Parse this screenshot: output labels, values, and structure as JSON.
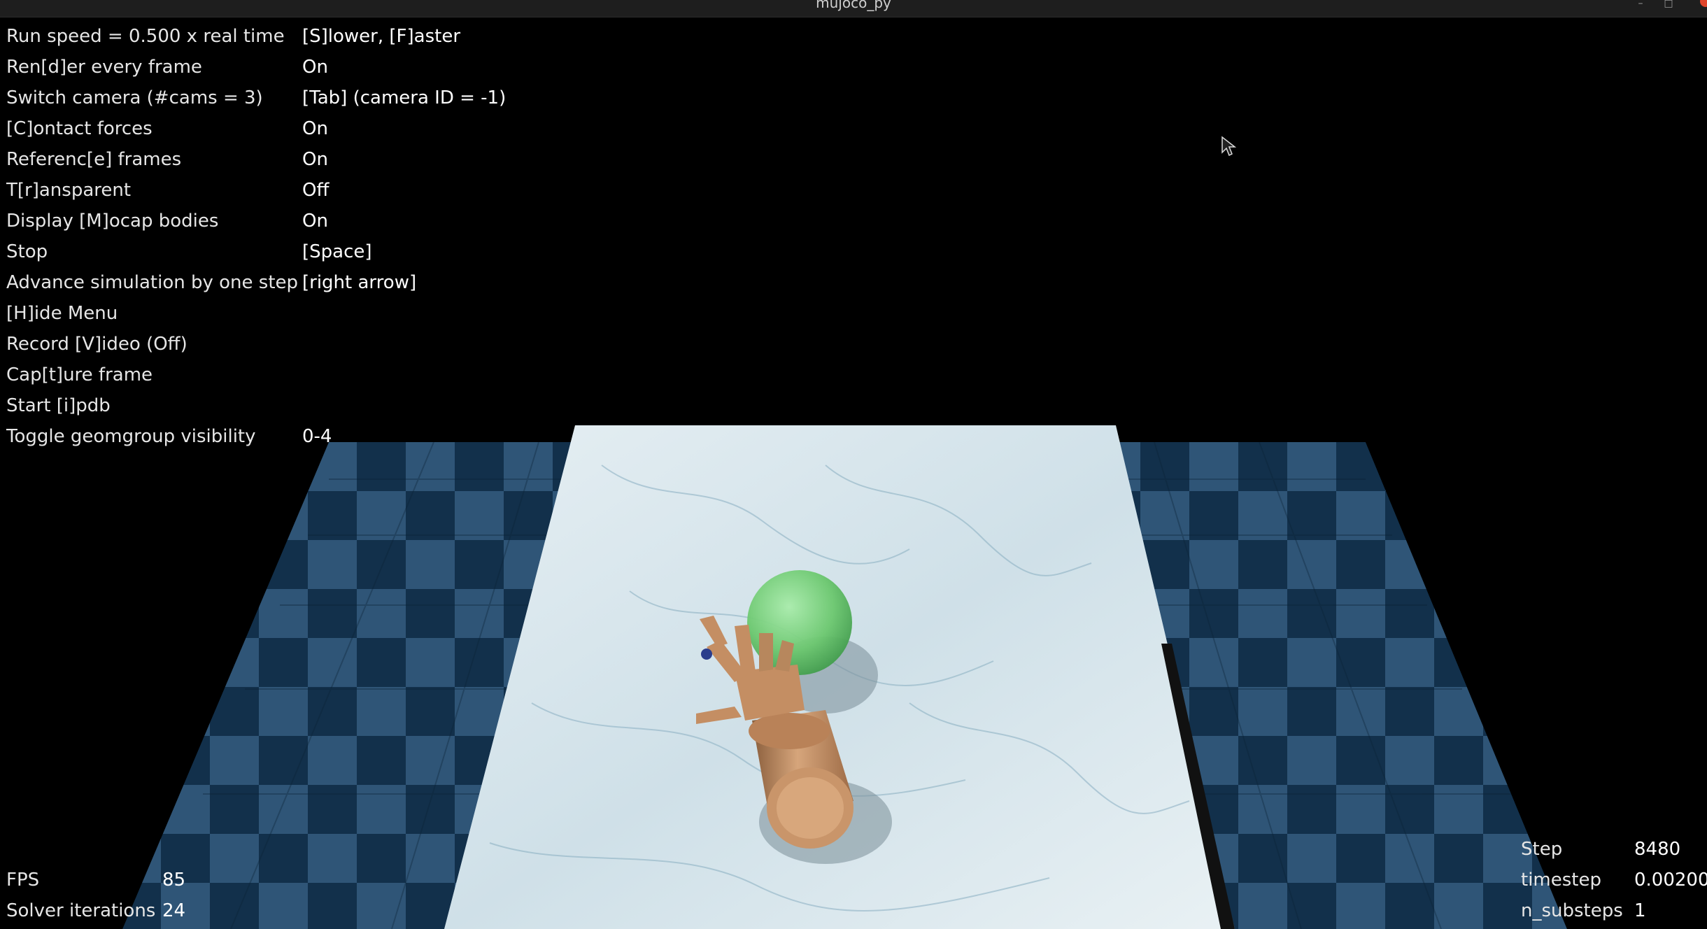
{
  "window": {
    "title": "mujoco_py"
  },
  "menu": {
    "rows": [
      {
        "key": "Run speed = 0.500 x real time",
        "value": "[S]lower, [F]aster"
      },
      {
        "key": "Ren[d]er every frame",
        "value": "On"
      },
      {
        "key": "Switch camera (#cams = 3)",
        "value": "[Tab] (camera ID = -1)"
      },
      {
        "key": "[C]ontact forces",
        "value": "On"
      },
      {
        "key": "Referenc[e] frames",
        "value": "On"
      },
      {
        "key": "T[r]ansparent",
        "value": "Off"
      },
      {
        "key": "Display [M]ocap bodies",
        "value": "On"
      },
      {
        "key": "Stop",
        "value": "[Space]"
      },
      {
        "key": "Advance simulation by one step",
        "value": "[right arrow]"
      },
      {
        "key": "[H]ide Menu",
        "value": ""
      },
      {
        "key": "Record [V]ideo (Off)",
        "value": ""
      },
      {
        "key": "Cap[t]ure frame",
        "value": ""
      },
      {
        "key": "Start [i]pdb",
        "value": ""
      },
      {
        "key": "Toggle geomgroup visibility",
        "value": "0-4"
      }
    ]
  },
  "stats_left": {
    "fps_label": "FPS",
    "fps_value": "85",
    "solver_label": "Solver iterations",
    "solver_value": "24"
  },
  "stats_right": {
    "step_label": "Step",
    "step_value": "8480",
    "timestep_label": "timestep",
    "timestep_value": "0.00200",
    "substeps_label": "n_substeps",
    "substeps_value": "1"
  },
  "colors": {
    "checker_dark": "#0f2a42",
    "checker_light": "#2f5577",
    "marble": "#d9e6ec",
    "ball": "#7fd07a",
    "hand": "#c9956a"
  }
}
